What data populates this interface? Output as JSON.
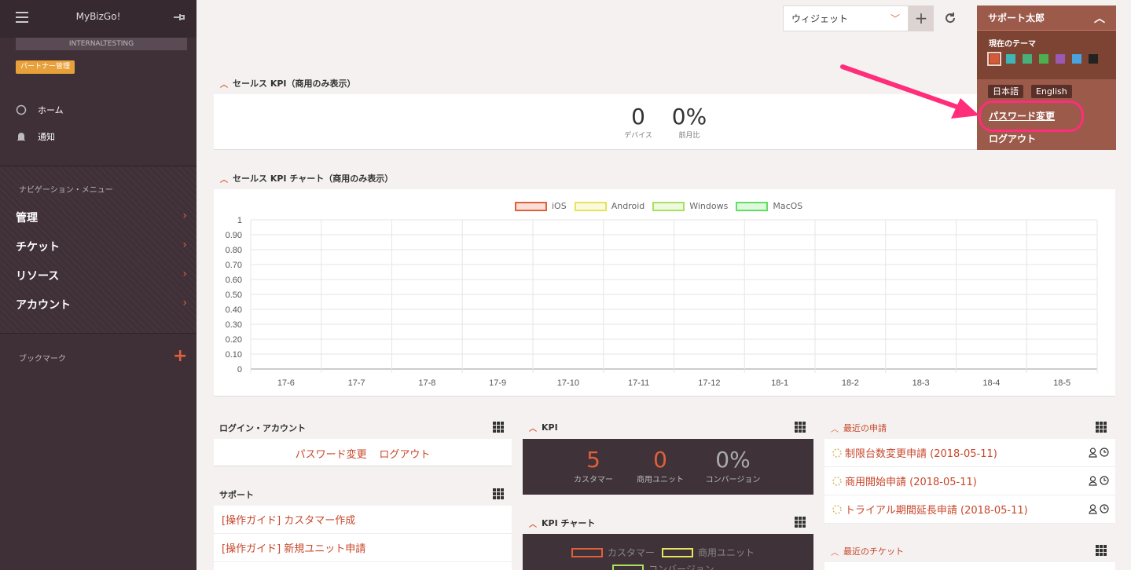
{
  "sidebar": {
    "brand": "MyBizGo!",
    "env": "INTERNALTESTING",
    "partner": "パートナー管理",
    "home": "ホーム",
    "notice": "通知",
    "nav_head": "ナビゲーション・メニュー",
    "nav": [
      "管理",
      "チケット",
      "リソース",
      "アカウント"
    ],
    "bookmark": "ブックマーク"
  },
  "topbar": {
    "widget_select": "ウィジェット"
  },
  "user_menu": {
    "name": "サポート太郎",
    "theme_label": "現在のテーマ",
    "theme_colors": [
      "#d65a3a",
      "#3fb6b6",
      "#48b07a",
      "#4caf50",
      "#9b59b6",
      "#4aa3df",
      "#222222"
    ],
    "lang_ja": "日本語",
    "lang_en": "English",
    "password": "パスワード変更",
    "logout": "ログアウト"
  },
  "sales_kpi": {
    "title": "セールス KPI（商用のみ表示）",
    "devices": "0",
    "devices_label": "デバイス",
    "mom": "0%",
    "mom_label": "前月比"
  },
  "chart_data": {
    "type": "line",
    "title": "セールス KPI チャート（商用のみ表示）",
    "categories": [
      "17-6",
      "17-7",
      "17-8",
      "17-9",
      "17-10",
      "17-11",
      "17-12",
      "18-1",
      "18-2",
      "18-3",
      "18-4",
      "18-5"
    ],
    "yticks": [
      "1",
      "0.90",
      "0.80",
      "0.70",
      "0.60",
      "0.50",
      "0.40",
      "0.30",
      "0.20",
      "0.10",
      "0"
    ],
    "ylim": [
      0,
      1
    ],
    "series": [
      {
        "name": "iOS",
        "color": "#e0603a",
        "values": []
      },
      {
        "name": "Android",
        "color": "#e6e45a",
        "values": []
      },
      {
        "name": "Windows",
        "color": "#a8e060",
        "values": []
      },
      {
        "name": "MacOS",
        "color": "#60e060",
        "values": []
      }
    ],
    "legend": "top-center",
    "grid": true
  },
  "login_widget": {
    "title": "ログイン・アカウント",
    "password": "パスワード変更",
    "logout": "ログアウト"
  },
  "support_widget": {
    "title": "サポート",
    "items": [
      "[操作ガイド] カスタマー作成",
      "[操作ガイド] 新規ユニット申請"
    ]
  },
  "kpi_widget": {
    "title": "KPI",
    "customers": "5",
    "customers_label": "カスタマー",
    "units": "0",
    "units_label": "商用ユニット",
    "conv": "0%",
    "conv_label": "コンバージョン"
  },
  "kpi_chart": {
    "title": "KPI チャート",
    "legend": [
      "カスタマー",
      "商用ユニット",
      "コンバージョン"
    ]
  },
  "recent_requests": {
    "title": "最近の申請",
    "items": [
      "制限台数変更申請 (2018-05-11)",
      "商用開始申請 (2018-05-11)",
      "トライアル期間延長申請 (2018-05-11)"
    ]
  },
  "recent_tickets": {
    "title": "最近のチケット"
  }
}
